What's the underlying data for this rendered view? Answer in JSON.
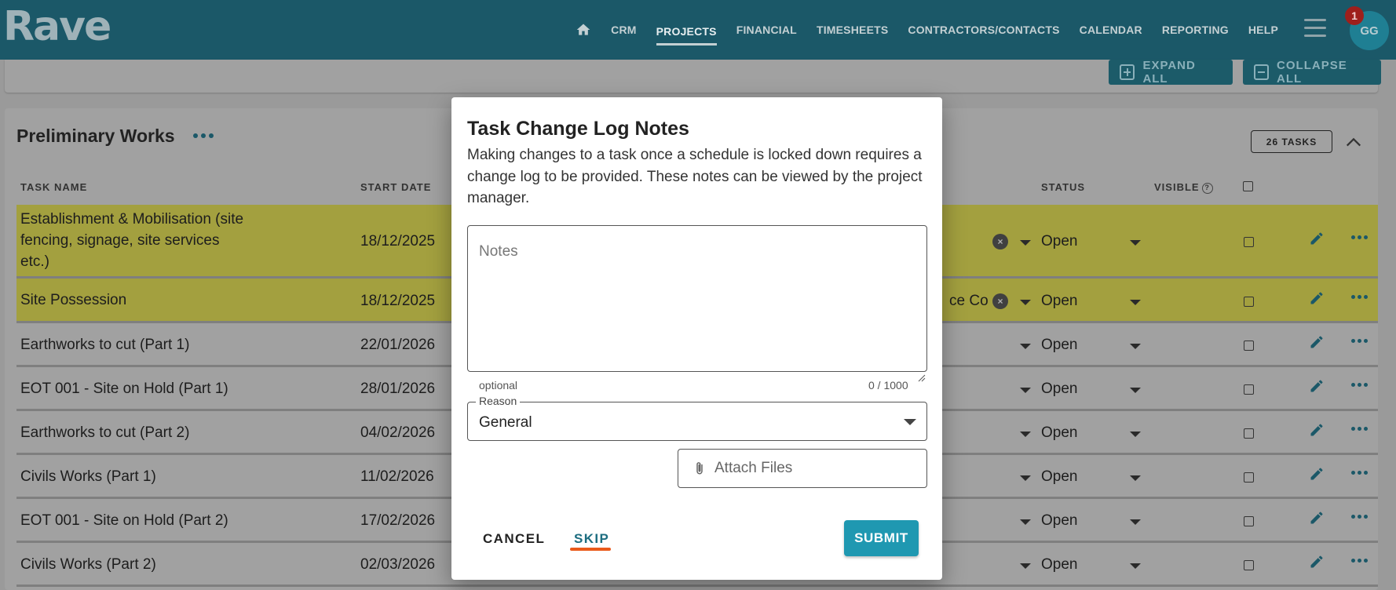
{
  "app": {
    "logo": "Rave",
    "user_initials": "GG",
    "notification_count": "1"
  },
  "nav": {
    "items": [
      "CRM",
      "PROJECTS",
      "FINANCIAL",
      "TIMESHEETS",
      "CONTRACTORS/CONTACTS",
      "CALENDAR",
      "REPORTING",
      "HELP"
    ],
    "active": "PROJECTS"
  },
  "toolbar": {
    "expand_all": "EXPAND ALL",
    "collapse_all": "COLLAPSE ALL"
  },
  "section": {
    "title": "Preliminary Works",
    "tasks_badge": "26 TASKS",
    "columns": {
      "task_name": "TASK NAME",
      "start_date": "START DATE",
      "status": "STATUS",
      "visible": "VISIBLE"
    },
    "rows": [
      {
        "name": "Establishment & Mobilisation (site fencing, signage, site services etc.)",
        "date": "18/12/2025",
        "status": "Open",
        "highlight": true,
        "clearable": true,
        "partial": ""
      },
      {
        "name": "Site Possession",
        "date": "18/12/2025",
        "status": "Open",
        "highlight": true,
        "clearable": true,
        "partial": "ce Co"
      },
      {
        "name": "Earthworks to cut (Part 1)",
        "date": "22/01/2026",
        "status": "Open",
        "highlight": false,
        "clearable": false,
        "partial": ""
      },
      {
        "name": "EOT 001 - Site on Hold (Part 1)",
        "date": "28/01/2026",
        "status": "Open",
        "highlight": false,
        "clearable": false,
        "partial": ""
      },
      {
        "name": "Earthworks to cut (Part 2)",
        "date": "04/02/2026",
        "status": "Open",
        "highlight": false,
        "clearable": false,
        "partial": ""
      },
      {
        "name": "Civils Works (Part 1)",
        "date": "11/02/2026",
        "status": "Open",
        "highlight": false,
        "clearable": false,
        "partial": ""
      },
      {
        "name": "EOT 001 - Site on Hold (Part 2)",
        "date": "17/02/2026",
        "status": "Open",
        "highlight": false,
        "clearable": false,
        "partial": ""
      },
      {
        "name": "Civils Works (Part 2)",
        "date": "02/03/2026",
        "status": "Open",
        "highlight": false,
        "clearable": false,
        "partial": ""
      }
    ]
  },
  "modal": {
    "title": "Task Change Log Notes",
    "description": "Making changes to a task once a schedule is locked down requires a change log to be provided. These notes can be viewed by the project manager.",
    "notes_placeholder": "Notes",
    "notes_value": "",
    "helper_text": "optional",
    "counter": "0 / 1000",
    "reason_label": "Reason",
    "reason_value": "General",
    "attach_label": "Attach Files",
    "cancel_label": "CANCEL",
    "skip_label": "SKIP",
    "submit_label": "SUBMIT"
  },
  "colors": {
    "topbar": "#1b5868",
    "row_highlight": "#a3a03f",
    "submit": "#1f98b1",
    "skip_underline": "#ea5a1b"
  }
}
